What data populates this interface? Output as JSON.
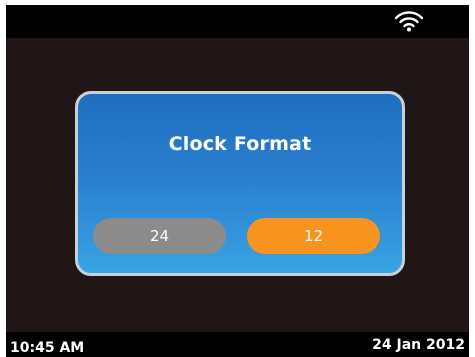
{
  "status_bar": {
    "wifi_icon": "wifi-icon"
  },
  "dialog": {
    "title": "Clock Format",
    "options": [
      {
        "label": "24",
        "selected": false,
        "color": "#8b8b8b"
      },
      {
        "label": "12",
        "selected": true,
        "color": "#f6941f"
      }
    ]
  },
  "footer": {
    "time": "10:45 AM",
    "date": "24 Jan 2012"
  },
  "colors": {
    "background": "#211616",
    "bar": "#000000",
    "dialog_top": "#1f6ebf",
    "dialog_bottom": "#38a3e4",
    "dialog_border": "#c9d1d6"
  }
}
